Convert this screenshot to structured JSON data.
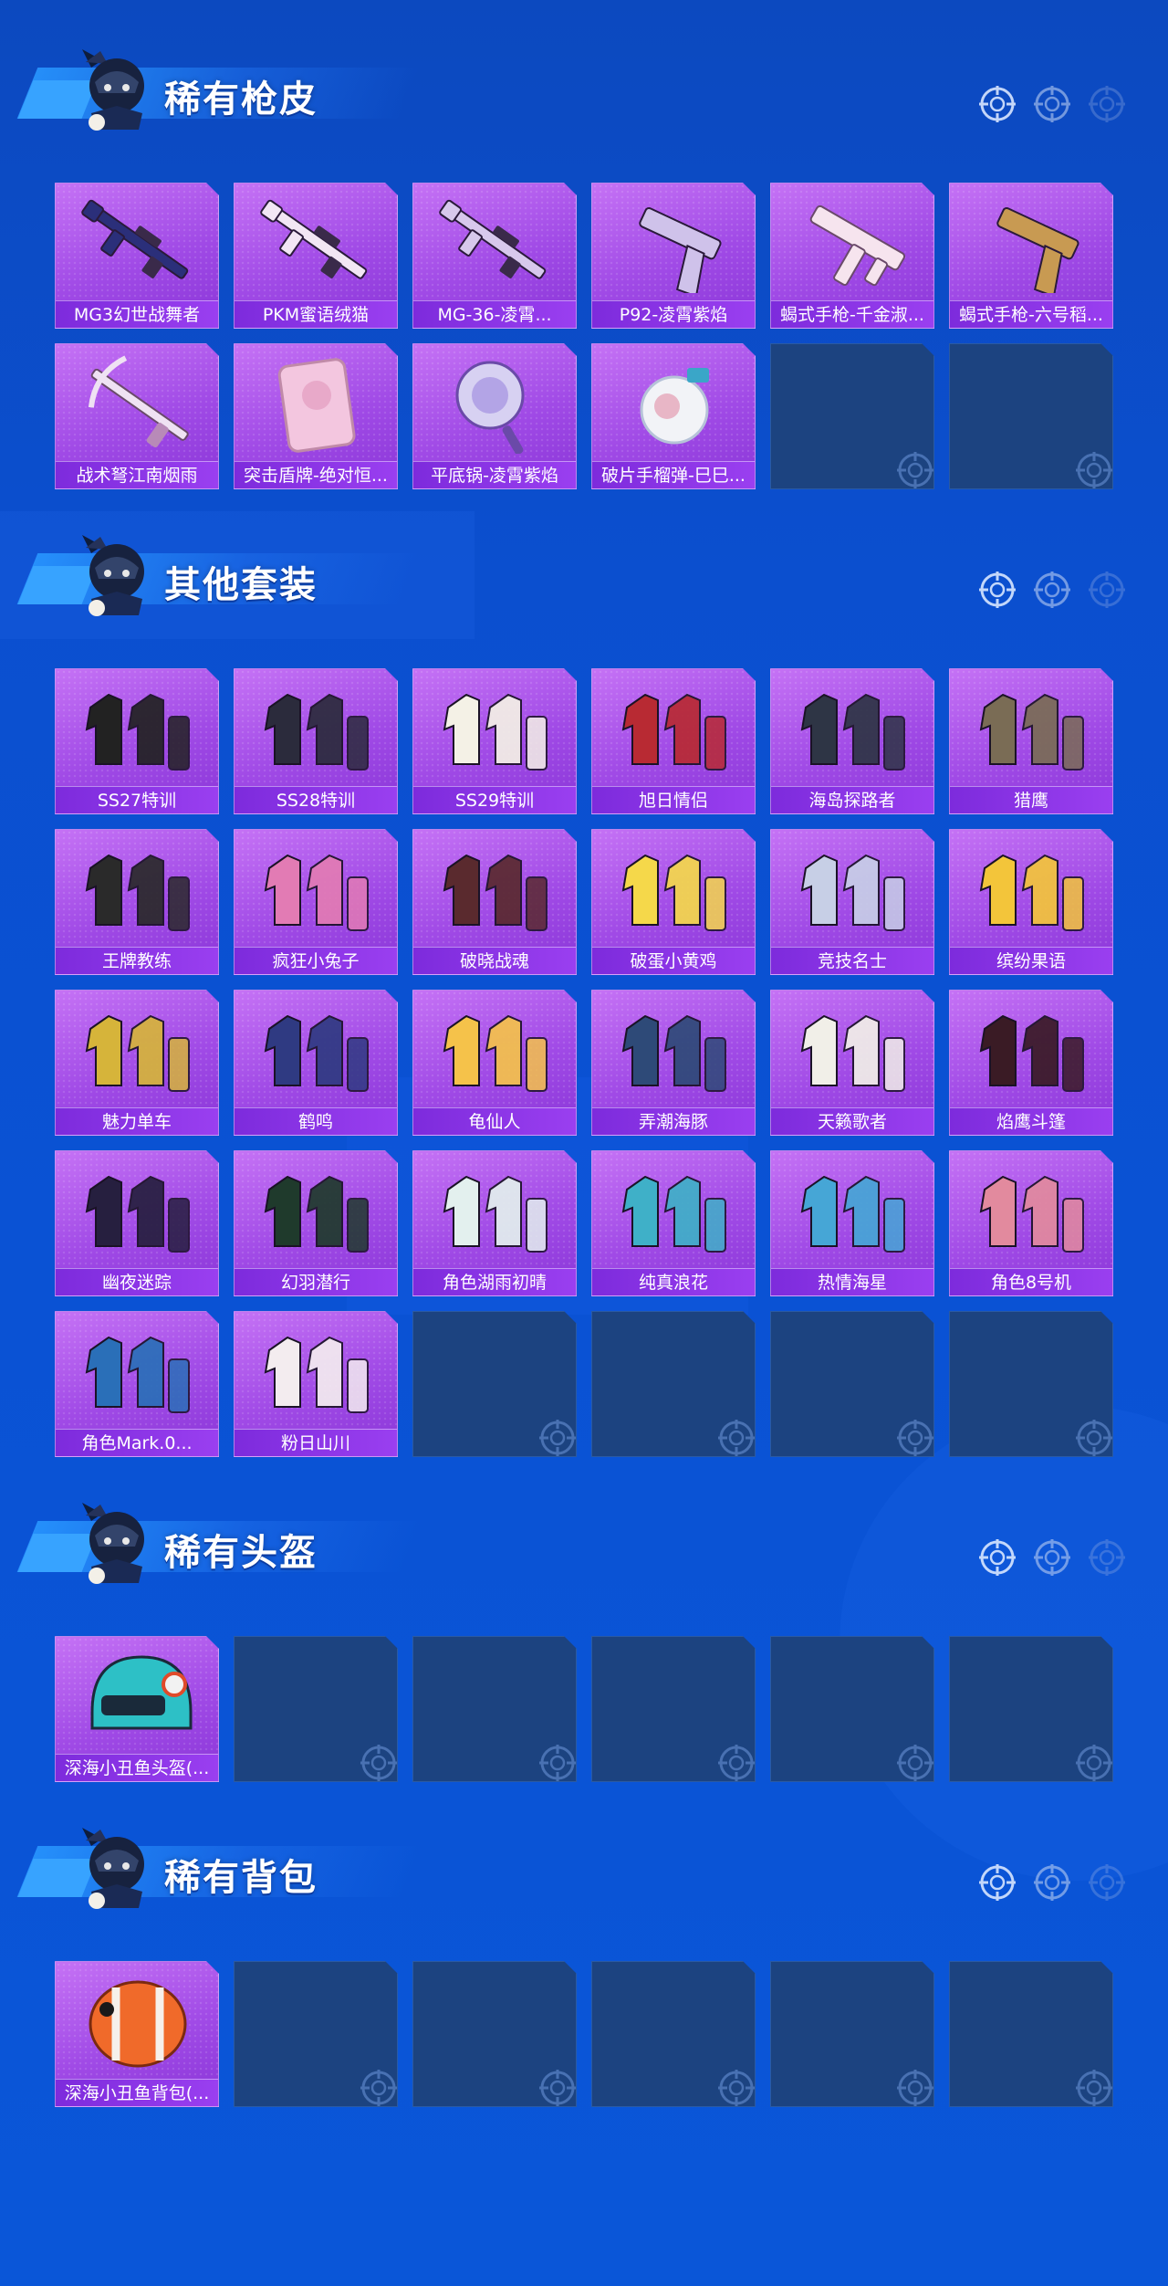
{
  "sections": [
    {
      "title": "稀有枪皮",
      "items": [
        {
          "label": "MG3幻世战舞者",
          "icon": "gun-icon",
          "color": "#2b2f7a"
        },
        {
          "label": "PKM蜜语绒猫",
          "icon": "gun-icon",
          "color": "#f2e6f4"
        },
        {
          "label": "MG-36-凌霄...",
          "icon": "gun-icon",
          "color": "#d7c8ec"
        },
        {
          "label": "P92-凌霄紫焰",
          "icon": "pistol-icon",
          "color": "#cfc2ea"
        },
        {
          "label": "蝎式手枪-千金淑...",
          "icon": "smg-icon",
          "color": "#f6e4ee"
        },
        {
          "label": "蝎式手枪-六号稻...",
          "icon": "pistol-icon",
          "color": "#c89a52"
        },
        {
          "label": "战术弩江南烟雨",
          "icon": "crossbow-icon",
          "color": "#efe2f3"
        },
        {
          "label": "突击盾牌-绝对恒...",
          "icon": "shield-icon",
          "color": "#f3c6df"
        },
        {
          "label": "平底锅-凌霄紫焰",
          "icon": "pan-icon",
          "color": "#d7d1f2"
        },
        {
          "label": "破片手榴弹-巳巳...",
          "icon": "grenade-icon",
          "color": "#f2f3f7"
        }
      ],
      "slots": 12
    },
    {
      "title": "其他套装",
      "items": [
        {
          "label": "SS27特训",
          "icon": "outfit-icon",
          "color": "#222222"
        },
        {
          "label": "SS28特训",
          "icon": "outfit-icon",
          "color": "#2b2b3c"
        },
        {
          "label": "SS29特训",
          "icon": "outfit-icon",
          "color": "#f4f1e6"
        },
        {
          "label": "旭日情侣",
          "icon": "outfit-icon",
          "color": "#b82a33"
        },
        {
          "label": "海岛探路者",
          "icon": "outfit-icon",
          "color": "#2e3545"
        },
        {
          "label": "猎鹰",
          "icon": "outfit-icon",
          "color": "#7a6c55"
        },
        {
          "label": "王牌教练",
          "icon": "outfit-icon",
          "color": "#2a2a2a"
        },
        {
          "label": "疯狂小兔子",
          "icon": "outfit-icon",
          "color": "#e27bb4"
        },
        {
          "label": "破晓战魂",
          "icon": "outfit-icon",
          "color": "#5a2a2e"
        },
        {
          "label": "破蛋小黄鸡",
          "icon": "outfit-icon",
          "color": "#f5d84a"
        },
        {
          "label": "竞技名士",
          "icon": "outfit-icon",
          "color": "#c7cfe6"
        },
        {
          "label": "缤纷果语",
          "icon": "outfit-icon",
          "color": "#f3c53a"
        },
        {
          "label": "魅力单车",
          "icon": "outfit-icon",
          "color": "#d6b43a"
        },
        {
          "label": "鹤鸣",
          "icon": "outfit-icon",
          "color": "#2f3a82"
        },
        {
          "label": "龟仙人",
          "icon": "outfit-icon",
          "color": "#f5c24a"
        },
        {
          "label": "弄潮海豚",
          "icon": "outfit-icon",
          "color": "#2e4a78"
        },
        {
          "label": "天籁歌者",
          "icon": "outfit-icon",
          "color": "#f1efe8"
        },
        {
          "label": "焰鹰斗篷",
          "icon": "outfit-icon",
          "color": "#3a1b25"
        },
        {
          "label": "幽夜迷踪",
          "icon": "outfit-icon",
          "color": "#261f3f"
        },
        {
          "label": "幻羽潜行",
          "icon": "outfit-icon",
          "color": "#1f3a2c"
        },
        {
          "label": "角色湖雨初晴",
          "icon": "outfit-icon",
          "color": "#e3f0ee"
        },
        {
          "label": "纯真浪花",
          "icon": "outfit-icon",
          "color": "#3fb0c8"
        },
        {
          "label": "热情海星",
          "icon": "outfit-icon",
          "color": "#46a6d6"
        },
        {
          "label": "角色8号机",
          "icon": "outfit-icon",
          "color": "#e28a9e"
        },
        {
          "label": "角色Mark.0...",
          "icon": "outfit-icon",
          "color": "#2a6fb8"
        },
        {
          "label": "粉日山川",
          "icon": "outfit-icon",
          "color": "#f3ecef"
        }
      ],
      "slots": 30
    },
    {
      "title": "稀有头盔",
      "items": [
        {
          "label": "深海小丑鱼头盔(...",
          "icon": "helmet-icon",
          "color": "#2dc0c6"
        }
      ],
      "slots": 6
    },
    {
      "title": "稀有背包",
      "items": [
        {
          "label": "深海小丑鱼背包(...",
          "icon": "backpack-icon",
          "color": "#f06a2a"
        }
      ],
      "slots": 6
    }
  ]
}
